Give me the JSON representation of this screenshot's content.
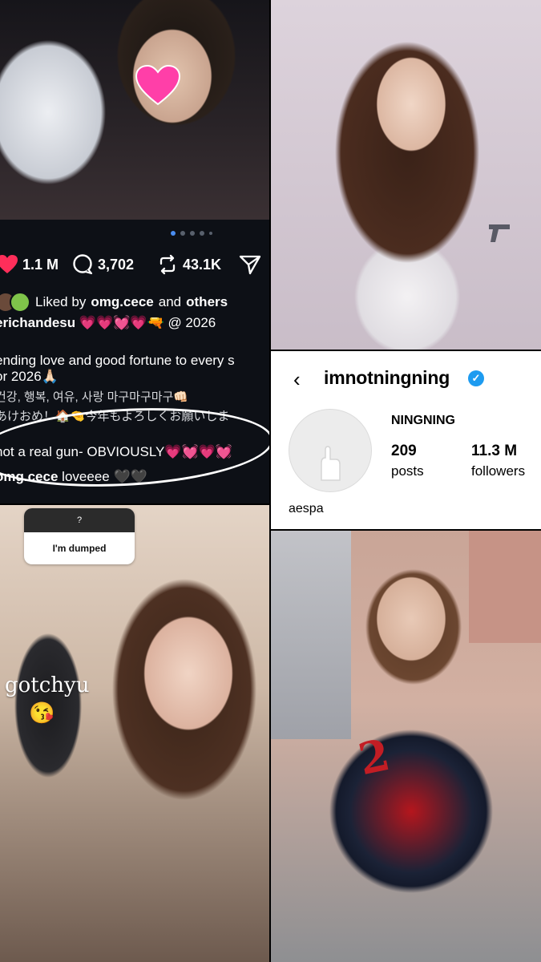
{
  "post": {
    "likes": "1.1 M",
    "comments": "3,702",
    "reposts": "43.1K",
    "liked_by_prefix": "Liked by",
    "liked_by_user": "omg.cece",
    "liked_by_and": "and",
    "liked_by_others": "others",
    "caption_user": "erichandesu",
    "caption_tail": "💗💗💓💗🔫 @ 2026",
    "line1": "ending love and good fortune to every s",
    "line2": "or 2026🙏🏻",
    "line3": "건강, 행복, 여유, 사랑 마구마구마구👊🏻",
    "line4": "あけおめ！🏠🤏今年もよろしくお願いしま",
    "line5": "not a real gun- OBVIOUSLY💗💓💗💓",
    "comment_user": "omg.cece",
    "comment_text": "loveeee 🖤🖤"
  },
  "profile": {
    "back_glyph": "‹",
    "username": "imnotningning",
    "verified_glyph": "✓",
    "display_name": "NINGNING",
    "posts_count": "209",
    "posts_label": "posts",
    "followers_count": "11.3 M",
    "followers_label": "followers",
    "bio": "aespa"
  },
  "story": {
    "question_mark": "?",
    "answer": "I'm dumped",
    "sticker_text": "gotchyu",
    "sticker_emoji": "😘"
  },
  "jacket": {
    "print": "2"
  },
  "colors": {
    "heart": "#ff2e5a",
    "verified": "#1d9bf0",
    "dot_active": "#4a8df0"
  },
  "icons": [
    "heart-icon",
    "comment-icon",
    "repost-icon",
    "share-icon",
    "back-icon",
    "verified-icon"
  ]
}
